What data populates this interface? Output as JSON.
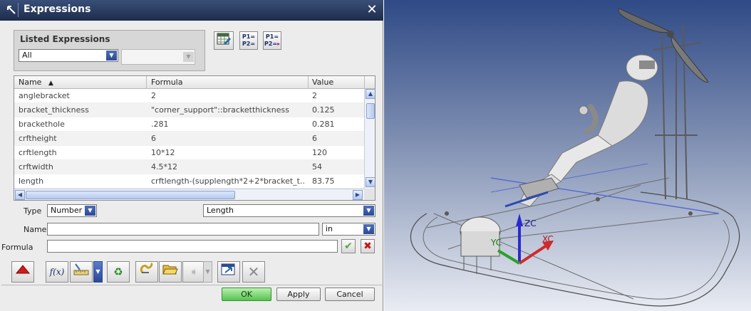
{
  "window": {
    "title": "Expressions"
  },
  "listed": {
    "label": "Listed Expressions",
    "filter_value": "All",
    "secondary_value": ""
  },
  "table": {
    "columns": [
      "Name",
      "Formula",
      "Value"
    ],
    "rows": [
      {
        "name": "anglebracket",
        "formula": "2",
        "value": "2"
      },
      {
        "name": "bracket_thickness",
        "formula": "\"corner_support\"::bracketthickness",
        "value": "0.125"
      },
      {
        "name": "brackethole",
        "formula": ".281",
        "value": "0.281"
      },
      {
        "name": "crftheight",
        "formula": "6",
        "value": "6"
      },
      {
        "name": "crftlength",
        "formula": "10*12",
        "value": "120"
      },
      {
        "name": "crftwidth",
        "formula": "4.5*12",
        "value": "54"
      },
      {
        "name": "length",
        "formula": "crftlength-(supplength*2+2*bracket_t...",
        "value": "83.75"
      }
    ]
  },
  "type_row": {
    "label": "Type",
    "type_value": "Number",
    "dimension_value": "Length"
  },
  "name_row": {
    "label": "Name",
    "value": "",
    "unit_value": "in"
  },
  "formula_row": {
    "label": "Formula",
    "value": ""
  },
  "buttons": {
    "ok": "OK",
    "apply": "Apply",
    "cancel": "Cancel"
  },
  "viewport": {
    "axis_zc": "ZC",
    "axis_yc": "YC",
    "axis_xc": "XC"
  },
  "colors": {
    "title_bar": "#1c2c4c",
    "ok_button": "#58c250",
    "viewport_top": "#2f4a86"
  }
}
